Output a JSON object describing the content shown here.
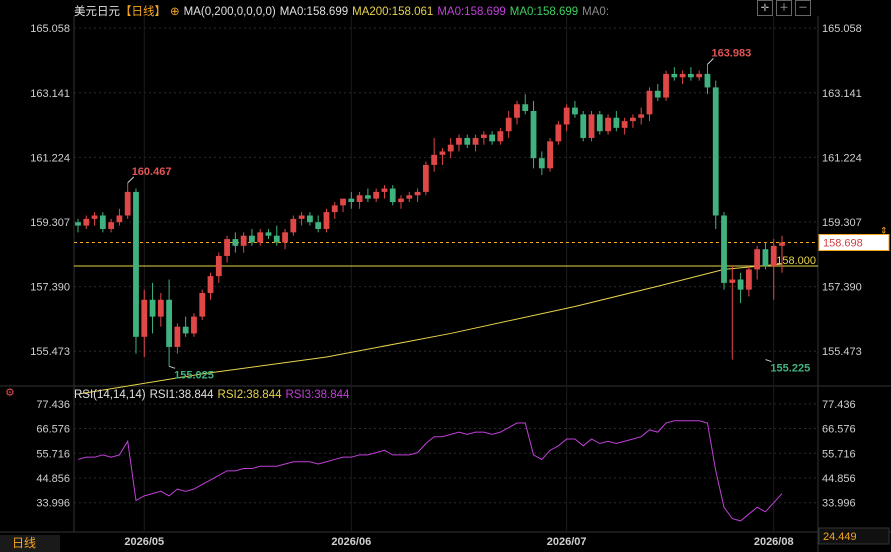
{
  "header": {
    "symbol": "美元日元",
    "period": "【日线】",
    "ma_params": "MA(0,200,0,0,0,0)",
    "ma_main": "MA0:158.699",
    "ma200": "MA200:158.061",
    "ma0_a": "MA0:158.699",
    "ma0_b": "MA0:158.699",
    "ma0_c": "MA0:"
  },
  "rsi_header": {
    "params": "RSI(14,14,14)",
    "rsi1": "RSI1:38.844",
    "rsi2": "RSI2:38.844",
    "rsi3": "RSI3:38.844"
  },
  "bottom_label": "日线",
  "colors": {
    "up": "#e04848",
    "down": "#3fb27f",
    "ma200": "#e8d44d",
    "rsi": "#c040d8",
    "grid": "#2a2a2a",
    "axis_text": "#cfcfcf",
    "accent": "#f5a623"
  },
  "chart_data": {
    "type": "candlestick",
    "price_axis": {
      "ticks": [
        "165.058",
        "163.141",
        "161.224",
        "159.307",
        "157.390",
        "155.473"
      ],
      "range": [
        154.5,
        165.3
      ]
    },
    "rsi_axis": {
      "ticks": [
        "77.436",
        "66.576",
        "55.716",
        "44.856",
        "33.996"
      ],
      "range": [
        22,
        80
      ]
    },
    "x_ticks": [
      "2026/05",
      "2026/06",
      "2026/07",
      "2026/08"
    ],
    "x_tick_index": [
      8,
      33,
      59,
      84
    ],
    "annotations": [
      {
        "label": "160.467",
        "index": 6,
        "value": 160.467,
        "kind": "high"
      },
      {
        "label": "155.025",
        "index": 11,
        "value": 155.025,
        "kind": "low"
      },
      {
        "label": "163.983",
        "index": 76,
        "value": 163.983,
        "kind": "high"
      },
      {
        "label": "155.225",
        "index": 83,
        "value": 155.225,
        "kind": "low"
      }
    ],
    "current_price_label": "158.698",
    "current_price": 158.698,
    "level_label": "158.000",
    "level_value": 158.0,
    "rsi_current_label": "24.449",
    "candles": [
      [
        159.3,
        159.4,
        159.0,
        159.2
      ],
      [
        159.2,
        159.5,
        159.1,
        159.4
      ],
      [
        159.4,
        159.6,
        159.2,
        159.5
      ],
      [
        159.5,
        159.6,
        159.0,
        159.1
      ],
      [
        159.1,
        159.4,
        159.0,
        159.3
      ],
      [
        159.3,
        159.7,
        159.2,
        159.5
      ],
      [
        159.5,
        160.467,
        159.4,
        160.2
      ],
      [
        160.2,
        160.3,
        155.4,
        155.9
      ],
      [
        155.9,
        157.3,
        155.3,
        157.0
      ],
      [
        157.0,
        157.5,
        156.0,
        156.5
      ],
      [
        156.5,
        157.2,
        156.2,
        157.0
      ],
      [
        157.0,
        157.6,
        155.025,
        155.6
      ],
      [
        155.6,
        156.3,
        155.4,
        156.2
      ],
      [
        156.2,
        156.5,
        155.9,
        156.0
      ],
      [
        156.0,
        156.6,
        155.9,
        156.5
      ],
      [
        156.5,
        157.3,
        156.4,
        157.2
      ],
      [
        157.2,
        157.8,
        157.0,
        157.7
      ],
      [
        157.7,
        158.4,
        157.5,
        158.3
      ],
      [
        158.3,
        158.9,
        158.1,
        158.8
      ],
      [
        158.8,
        159.0,
        158.4,
        158.6
      ],
      [
        158.6,
        159.0,
        158.4,
        158.9
      ],
      [
        158.9,
        159.1,
        158.6,
        158.7
      ],
      [
        158.7,
        159.1,
        158.6,
        159.0
      ],
      [
        159.0,
        159.1,
        158.8,
        158.9
      ],
      [
        158.9,
        159.2,
        158.6,
        158.7
      ],
      [
        158.7,
        159.1,
        158.5,
        159.0
      ],
      [
        159.0,
        159.5,
        158.9,
        159.4
      ],
      [
        159.4,
        159.6,
        159.2,
        159.5
      ],
      [
        159.5,
        159.6,
        159.2,
        159.3
      ],
      [
        159.3,
        159.5,
        159.0,
        159.1
      ],
      [
        159.1,
        159.7,
        159.0,
        159.6
      ],
      [
        159.6,
        159.9,
        159.4,
        159.8
      ],
      [
        159.8,
        160.0,
        159.6,
        160.0
      ],
      [
        160.0,
        160.2,
        159.7,
        159.9
      ],
      [
        159.9,
        160.2,
        159.7,
        160.1
      ],
      [
        160.1,
        160.3,
        159.9,
        160.0
      ],
      [
        160.0,
        160.3,
        159.9,
        160.2
      ],
      [
        160.2,
        160.4,
        160.0,
        160.3
      ],
      [
        160.3,
        160.4,
        159.8,
        159.9
      ],
      [
        159.9,
        160.1,
        159.7,
        160.0
      ],
      [
        160.0,
        160.2,
        159.9,
        160.1
      ],
      [
        160.1,
        160.3,
        159.9,
        160.2
      ],
      [
        160.2,
        161.1,
        160.1,
        161.0
      ],
      [
        161.0,
        161.8,
        160.8,
        161.3
      ],
      [
        161.3,
        161.5,
        161.0,
        161.4
      ],
      [
        161.4,
        161.8,
        161.2,
        161.6
      ],
      [
        161.6,
        161.9,
        161.4,
        161.8
      ],
      [
        161.8,
        161.9,
        161.5,
        161.6
      ],
      [
        161.6,
        161.9,
        161.4,
        161.8
      ],
      [
        161.8,
        162.0,
        161.6,
        161.9
      ],
      [
        161.9,
        162.0,
        161.6,
        161.7
      ],
      [
        161.7,
        162.1,
        161.6,
        162.0
      ],
      [
        162.0,
        162.6,
        161.8,
        162.4
      ],
      [
        162.4,
        162.9,
        162.2,
        162.8
      ],
      [
        162.8,
        163.1,
        162.5,
        162.6
      ],
      [
        162.6,
        162.9,
        160.9,
        161.2
      ],
      [
        161.2,
        161.4,
        160.7,
        160.9
      ],
      [
        160.9,
        161.8,
        160.8,
        161.7
      ],
      [
        161.7,
        162.3,
        161.6,
        162.2
      ],
      [
        162.2,
        162.8,
        162.0,
        162.7
      ],
      [
        162.7,
        162.9,
        162.4,
        162.5
      ],
      [
        162.5,
        162.6,
        161.7,
        161.8
      ],
      [
        161.8,
        162.6,
        161.7,
        162.5
      ],
      [
        162.5,
        162.6,
        161.9,
        162.0
      ],
      [
        162.0,
        162.5,
        161.9,
        162.4
      ],
      [
        162.4,
        162.6,
        162.0,
        162.1
      ],
      [
        162.1,
        162.4,
        161.9,
        162.3
      ],
      [
        162.3,
        162.5,
        162.1,
        162.4
      ],
      [
        162.4,
        162.7,
        162.2,
        162.5
      ],
      [
        162.5,
        163.3,
        162.3,
        163.2
      ],
      [
        163.2,
        163.4,
        162.9,
        163.0
      ],
      [
        163.0,
        163.8,
        162.9,
        163.7
      ],
      [
        163.7,
        163.9,
        163.5,
        163.6
      ],
      [
        163.6,
        163.8,
        163.4,
        163.7
      ],
      [
        163.7,
        163.9,
        163.5,
        163.6
      ],
      [
        163.6,
        163.8,
        163.5,
        163.7
      ],
      [
        163.7,
        163.983,
        163.1,
        163.3
      ],
      [
        163.3,
        163.5,
        159.1,
        159.5
      ],
      [
        159.5,
        159.6,
        157.3,
        157.5
      ],
      [
        157.5,
        158.0,
        155.225,
        157.6
      ],
      [
        157.6,
        157.8,
        156.9,
        157.3
      ],
      [
        157.3,
        158.0,
        157.1,
        157.9
      ],
      [
        157.9,
        158.6,
        157.6,
        158.5
      ],
      [
        158.5,
        158.7,
        157.9,
        158.0
      ],
      [
        158.0,
        158.8,
        157.0,
        158.6
      ],
      [
        158.6,
        158.9,
        157.8,
        158.698
      ]
    ],
    "ma200_points": [
      [
        0,
        154.2
      ],
      [
        15,
        154.8
      ],
      [
        30,
        155.3
      ],
      [
        45,
        156.0
      ],
      [
        60,
        156.8
      ],
      [
        70,
        157.4
      ],
      [
        78,
        157.9
      ],
      [
        85,
        158.061
      ]
    ],
    "rsi": [
      53,
      54,
      54,
      55,
      54,
      55,
      61,
      35,
      37,
      38,
      39,
      37,
      40,
      39,
      40,
      42,
      44,
      46,
      48,
      48,
      49,
      49,
      50,
      50,
      50,
      51,
      52,
      52,
      52,
      51,
      52,
      53,
      54,
      54,
      55,
      55,
      56,
      57,
      55,
      55,
      55,
      56,
      60,
      63,
      63,
      64,
      65,
      64,
      65,
      65,
      64,
      65,
      67,
      69,
      69,
      55,
      53,
      57,
      59,
      62,
      62,
      59,
      62,
      60,
      61,
      60,
      61,
      62,
      63,
      66,
      65,
      69,
      70,
      70,
      70,
      70,
      69,
      48,
      32,
      27,
      26,
      29,
      32,
      30,
      34,
      38
    ]
  }
}
